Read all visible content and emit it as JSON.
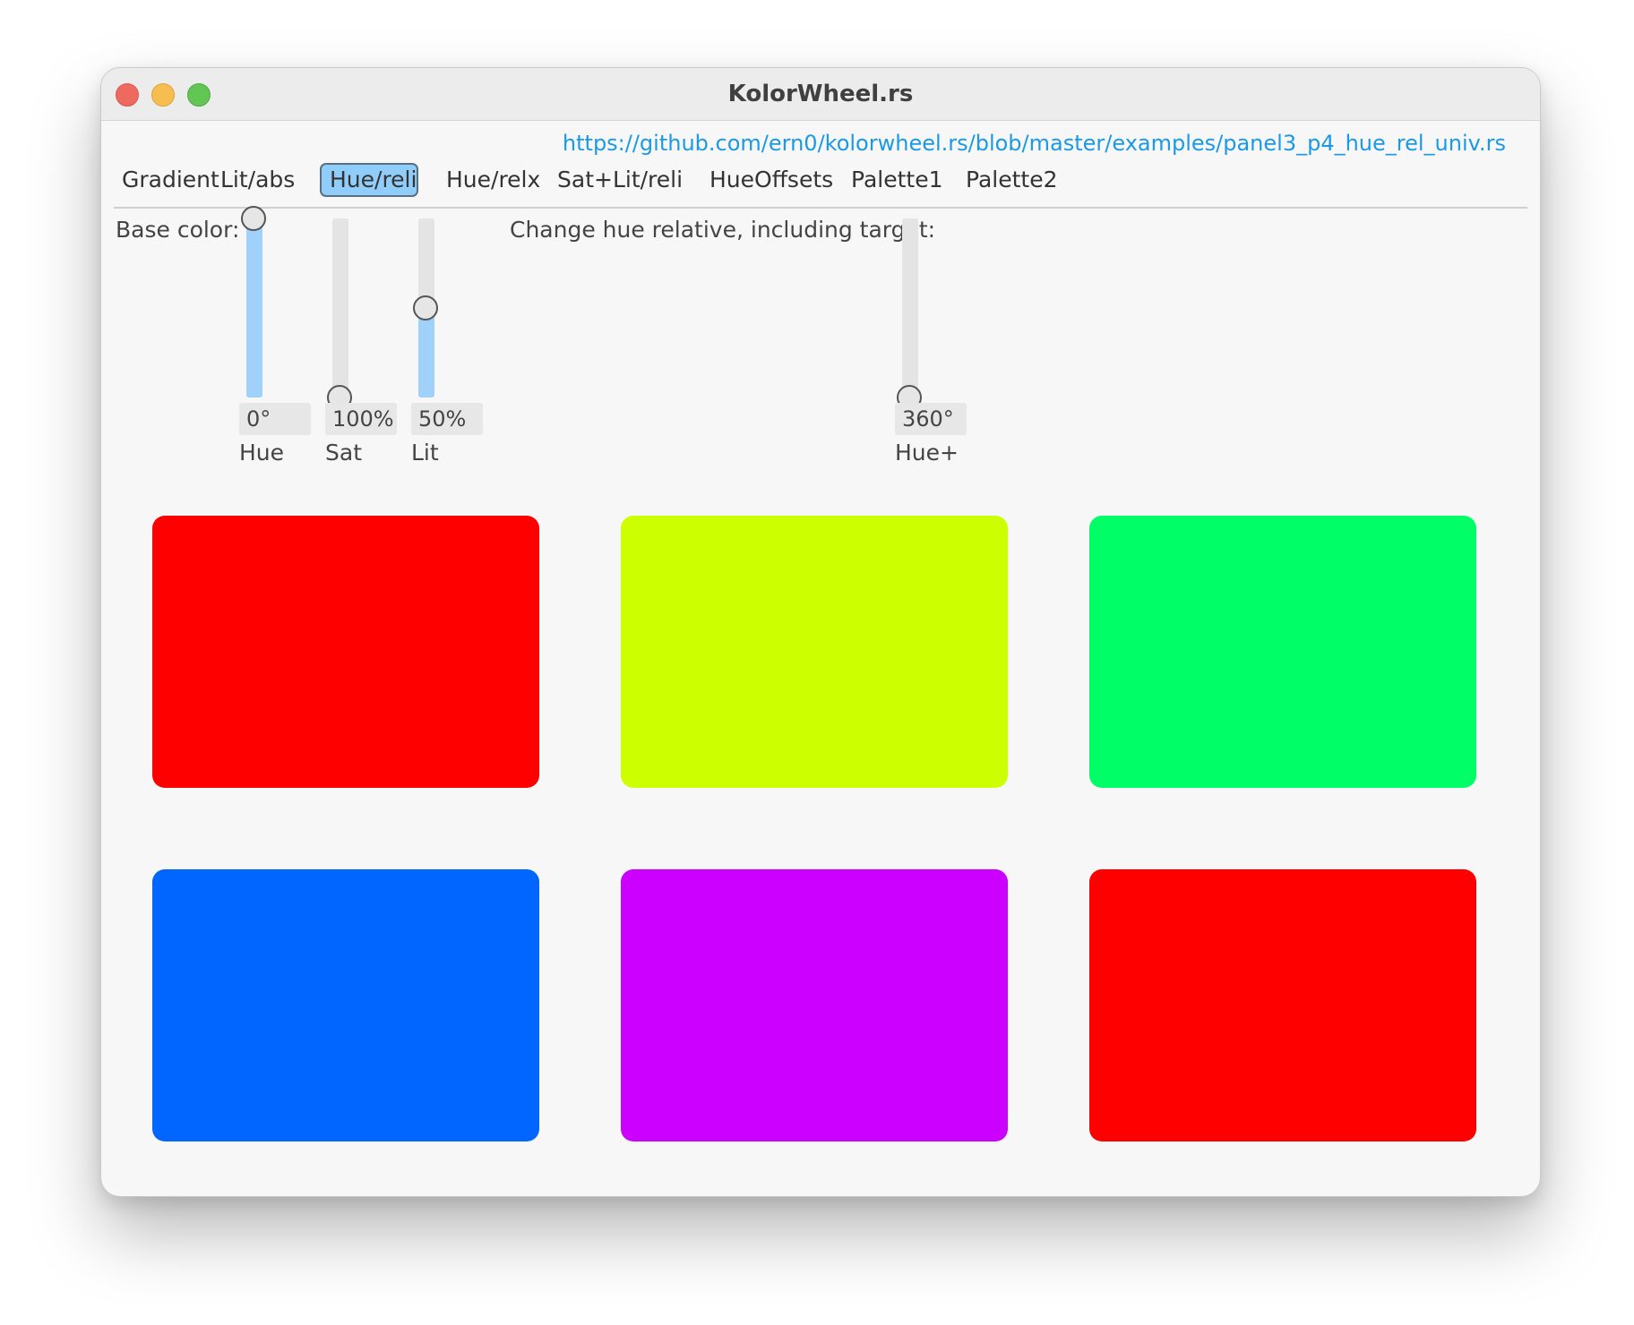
{
  "window": {
    "title": "KolorWheel.rs"
  },
  "link": "https://github.com/ern0/kolorwheel.rs/blob/master/examples/panel3_p4_hue_rel_univ.rs",
  "tabs": [
    {
      "label": "Gradient"
    },
    {
      "label": "Lit/abs"
    },
    {
      "label": "Hue/reli",
      "active": true
    },
    {
      "label": "Hue/relx"
    },
    {
      "label": "Sat+Lit/reli"
    },
    {
      "label": "HueOffsets"
    },
    {
      "label": "Palette1"
    },
    {
      "label": "Palette2"
    }
  ],
  "base": {
    "label": "Base color:",
    "sliders": [
      {
        "name": "Hue",
        "value": "0°",
        "fill_fraction": 1.0
      },
      {
        "name": "Sat",
        "value": "100%",
        "fill_fraction": 0.0
      },
      {
        "name": "Lit",
        "value": "50%",
        "fill_fraction": 0.5
      }
    ]
  },
  "change": {
    "label": "Change hue relative, including target:",
    "slider": {
      "name": "Hue+",
      "value": "360°",
      "fill_fraction": 0.0
    }
  },
  "swatches": [
    {
      "color": "#ff0000"
    },
    {
      "color": "#ccff00"
    },
    {
      "color": "#00ff66"
    },
    {
      "color": "#0066ff"
    },
    {
      "color": "#cc00ff"
    },
    {
      "color": "#ff0000"
    }
  ]
}
